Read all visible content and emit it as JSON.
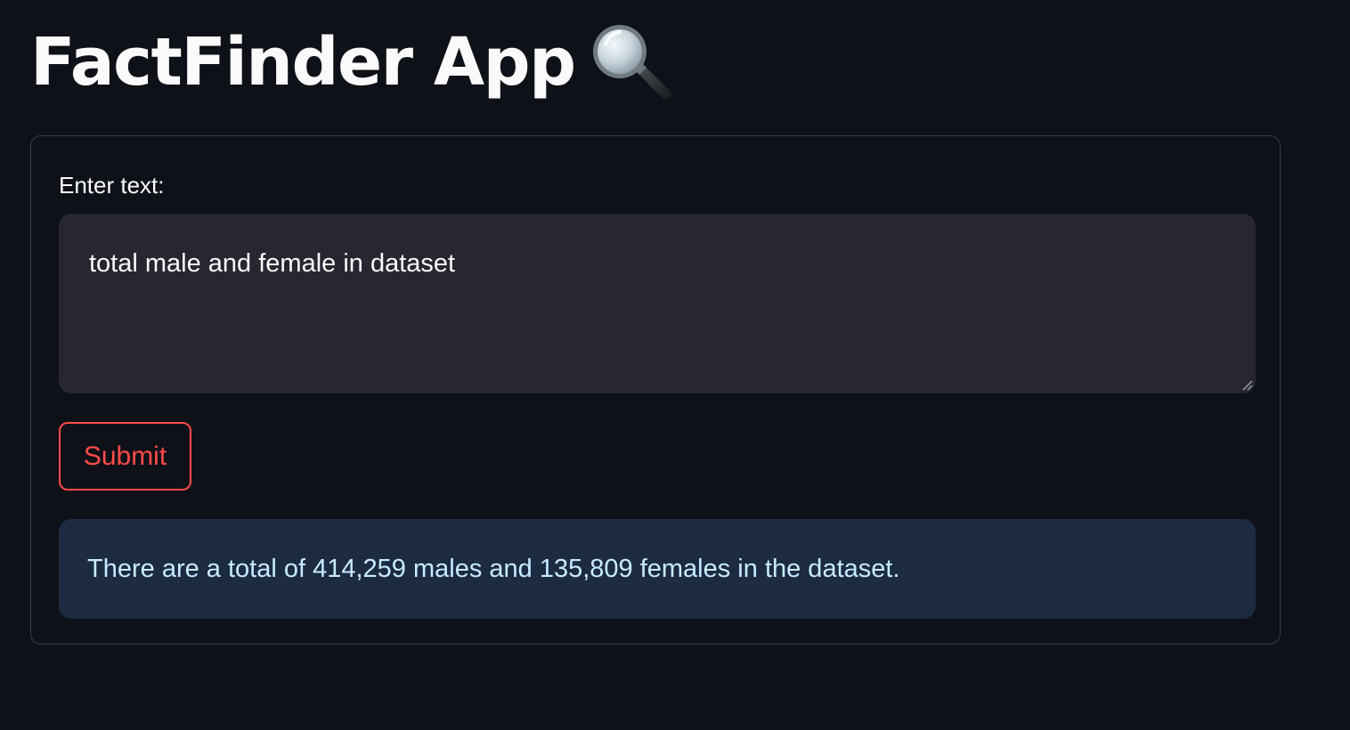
{
  "header": {
    "title": "FactFinder App",
    "title_icon": "magnifying-glass-emoji"
  },
  "form": {
    "input_label": "Enter text:",
    "input_value": "total male and female in dataset",
    "submit_label": "Submit"
  },
  "result": {
    "message": "There are a total of 414,259 males and 135,809 females in the dataset."
  },
  "colors": {
    "background": "#0e1117",
    "accent": "#ff4b4b",
    "input_background": "#262730",
    "info_background": "#1c2b42",
    "info_text": "#c7ebff"
  }
}
